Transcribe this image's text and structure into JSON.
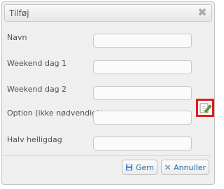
{
  "dialog": {
    "title": "Tilføj",
    "close_icon": "close-icon",
    "fields": [
      {
        "label": "Navn",
        "value": ""
      },
      {
        "label": "Weekend dag 1",
        "value": ""
      },
      {
        "label": "Weekend dag 2",
        "value": ""
      },
      {
        "label": "Option (ikke nødvendig)",
        "value": ""
      },
      {
        "label": "Halv helligdag",
        "value": ""
      }
    ],
    "option_edit_icon": "edit-icon",
    "highlight_color": "#e21b1b",
    "buttons": {
      "save_label": "Gem",
      "save_icon": "save-icon",
      "cancel_label": "Annuller",
      "cancel_icon": "cancel-icon"
    },
    "button_text_color": "#2a6fa5"
  }
}
